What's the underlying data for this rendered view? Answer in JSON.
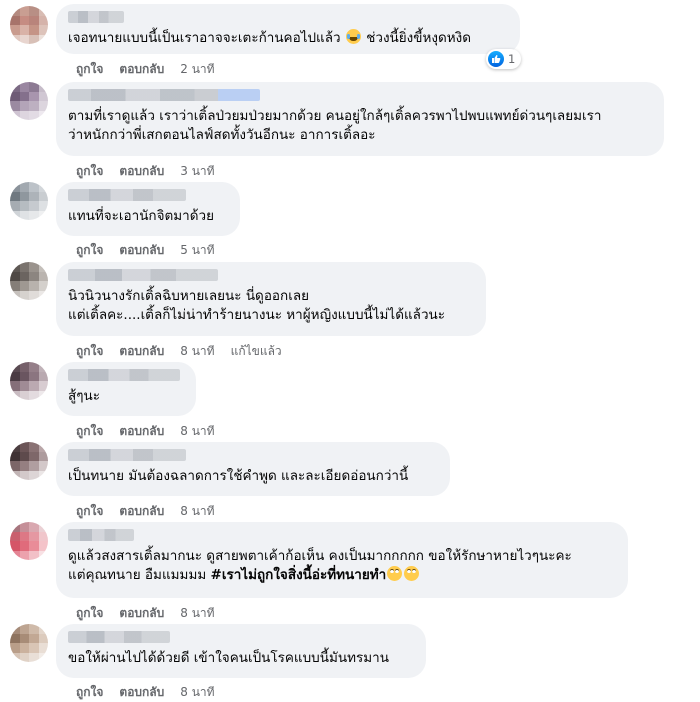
{
  "actions": {
    "like": "ถูกใจ",
    "reply": "ตอบกลับ"
  },
  "comments": [
    {
      "lines": [
        "เจอทนายแบบนี้เป็นเราอาจจะเตะก้านคอไปแล้ว",
        "ช่วงนี้ยิ่งขี้หงุดหงิด"
      ],
      "emoji": "laughing-tears",
      "time": "2 นาที",
      "reaction_count": "1"
    },
    {
      "lines": [
        "ตามที่เราดูแล้ว เราว่าเติ้ลป่วยมป่วยมากด้วย คนอยู่ใกล้ๆเติ้ลควรพาไปพบแพทย์ด่วนๆเลยมเรา",
        "ว่าหนักกว่าพี่เสกตอนไลฟ์สดทั้งวันอีกนะ อาการเติ้ลอะ"
      ],
      "time": "3 นาที"
    },
    {
      "lines": [
        "แทนที่จะเอานักจิตมาด้วย"
      ],
      "time": "5 นาที"
    },
    {
      "lines": [
        "นิวนิวนางรักเติ้ลฉิบหายเลยนะ นี่ดูออกเลย",
        "แต่เติ้ลคะ....เติ้ลก็ไม่น่าทำร้ายนางนะ หาผู้หญิงแบบนี้ไม่ได้แล้วนะ"
      ],
      "time": "8 นาที",
      "edited": "แก้ไขแล้ว"
    },
    {
      "lines": [
        "สู้ๆนะ"
      ],
      "time": "8 นาที"
    },
    {
      "lines": [
        "เป็นทนาย มันต้องฉลาดการใช้คำพูด และละเอียดอ่อนกว่านี้"
      ],
      "time": "8 นาที"
    },
    {
      "lines": [
        "ดูแล้วสงสารเติ้ลมากนะ ดูสายพตาเค้าก้อเห็น คงเป็นมากกกกก ขอให้รักษาหายไวๆนะคะ"
      ],
      "line2_prefix": "แต่คุณทนาย อืมแมมมม ",
      "hashtag": "#เราไม่ถูกใจสิ่งนี้อ่ะที่ทนายทำ",
      "emoji": "face-with-rolling-eyes",
      "time": "8 นาที"
    },
    {
      "lines": [
        "ขอให้ผ่านไปได้ด้วยดี เข้าใจคนเป็นโรคแบบนี้มันทรมาน"
      ],
      "time": "8 นาที"
    }
  ],
  "icons": {
    "reaction": "like-icon"
  },
  "colors": {
    "bubble": "#f0f2f5",
    "meta": "#65676b",
    "like_blue": "#1877f2"
  }
}
